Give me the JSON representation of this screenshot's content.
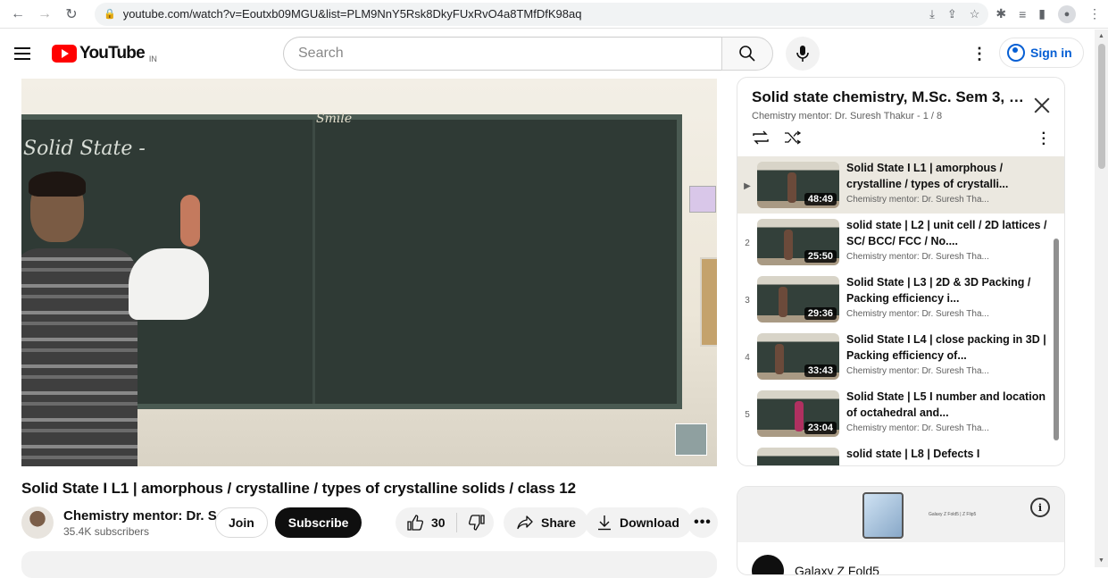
{
  "browser": {
    "url": "youtube.com/watch?v=Eoutxb09MGU&list=PLM9NnY5Rsk8DkyFUxRvO4a8TMfDfK98aq"
  },
  "masthead": {
    "logo_text": "YouTube",
    "country_code": "IN",
    "search_placeholder": "Search",
    "signin_label": "Sign in"
  },
  "player": {
    "chalk_top": "Smile",
    "chalk_left": "Solid State -"
  },
  "video": {
    "title": "Solid State I L1 | amorphous / crystalline / types of crystalline solids / class 12",
    "channel_name": "Chemistry mentor: Dr. S...",
    "subscribers": "35.4K subscribers",
    "join_label": "Join",
    "subscribe_label": "Subscribe",
    "likes": "30",
    "share_label": "Share",
    "download_label": "Download"
  },
  "playlist": {
    "title": "Solid state chemistry, M.Sc. Sem 3, 6...",
    "subtitle": "Chemistry mentor: Dr. Suresh Thakur - 1 / 8",
    "items": [
      {
        "index": "▶",
        "title": "Solid State I L1 | amorphous / crystalline / types of crystalli...",
        "channel": "Chemistry mentor: Dr. Suresh Tha...",
        "duration": "48:49",
        "active": true
      },
      {
        "index": "2",
        "title": "solid state | L2 | unit cell / 2D lattices / SC/ BCC/ FCC / No....",
        "channel": "Chemistry mentor: Dr. Suresh Tha...",
        "duration": "25:50"
      },
      {
        "index": "3",
        "title": "Solid State | L3 | 2D & 3D Packing / Packing efficiency i...",
        "channel": "Chemistry mentor: Dr. Suresh Tha...",
        "duration": "29:36"
      },
      {
        "index": "4",
        "title": "Solid State I L4 | close packing in 3D | Packing efficiency of...",
        "channel": "Chemistry mentor: Dr. Suresh Tha...",
        "duration": "33:43"
      },
      {
        "index": "5",
        "title": "Solid State | L5 I number and location of octahedral and...",
        "channel": "Chemistry mentor: Dr. Suresh Tha...",
        "duration": "23:04"
      },
      {
        "index": "",
        "title": "solid state | L8 | Defects I",
        "channel": "",
        "duration": ""
      }
    ]
  },
  "ad": {
    "name": "Galaxy Z Fold5",
    "tagline": "Galaxy Z Fold5 | Z Flip5"
  }
}
